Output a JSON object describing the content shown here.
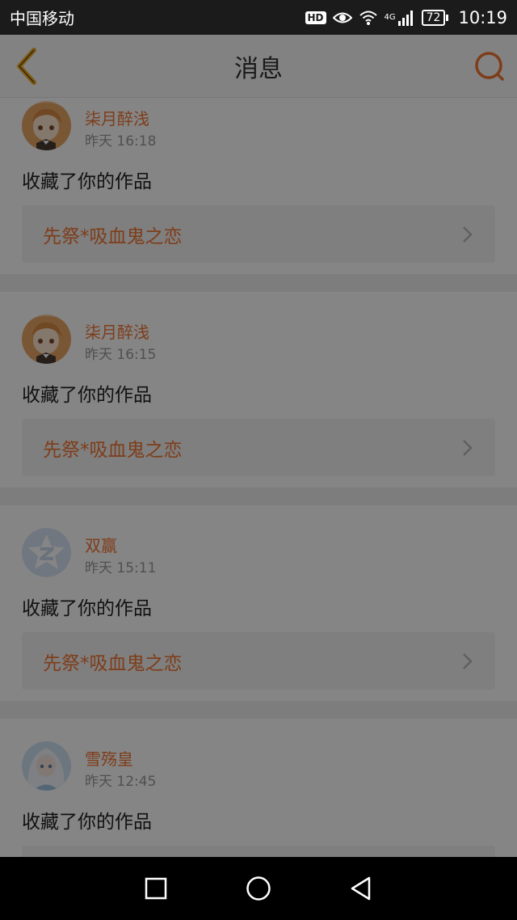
{
  "status_bar": {
    "carrier": "中国移动",
    "hd": "HD",
    "network": "4G",
    "battery": "72",
    "time": "10:19",
    "icons": [
      "hd-icon",
      "eye-icon",
      "wifi-icon",
      "signal-icon",
      "battery-icon"
    ]
  },
  "header": {
    "title": "消息",
    "back_icon": "back-chevron-icon",
    "search_icon": "search-icon"
  },
  "messages": [
    {
      "user": "柒月醉浅",
      "time": "昨天 16:18",
      "action": "收藏了你的作品",
      "work": "先祭*吸血鬼之恋",
      "avatar": "anime-girl-avatar"
    },
    {
      "user": "柒月醉浅",
      "time": "昨天 16:15",
      "action": "收藏了你的作品",
      "work": "先祭*吸血鬼之恋",
      "avatar": "anime-girl-avatar"
    },
    {
      "user": "双赢",
      "time": "昨天 15:11",
      "action": "收藏了你的作品",
      "work": "先祭*吸血鬼之恋",
      "avatar": "default-star-avatar"
    },
    {
      "user": "雪殇皇",
      "time": "昨天 12:45",
      "action": "收藏了你的作品",
      "work": "",
      "avatar": "white-hair-girl-avatar"
    }
  ],
  "colors": {
    "accent": "#f17532",
    "overlay": "rgba(0,0,0,0.48)"
  },
  "nav_bar": [
    "recent-apps-icon",
    "home-icon",
    "back-icon"
  ]
}
